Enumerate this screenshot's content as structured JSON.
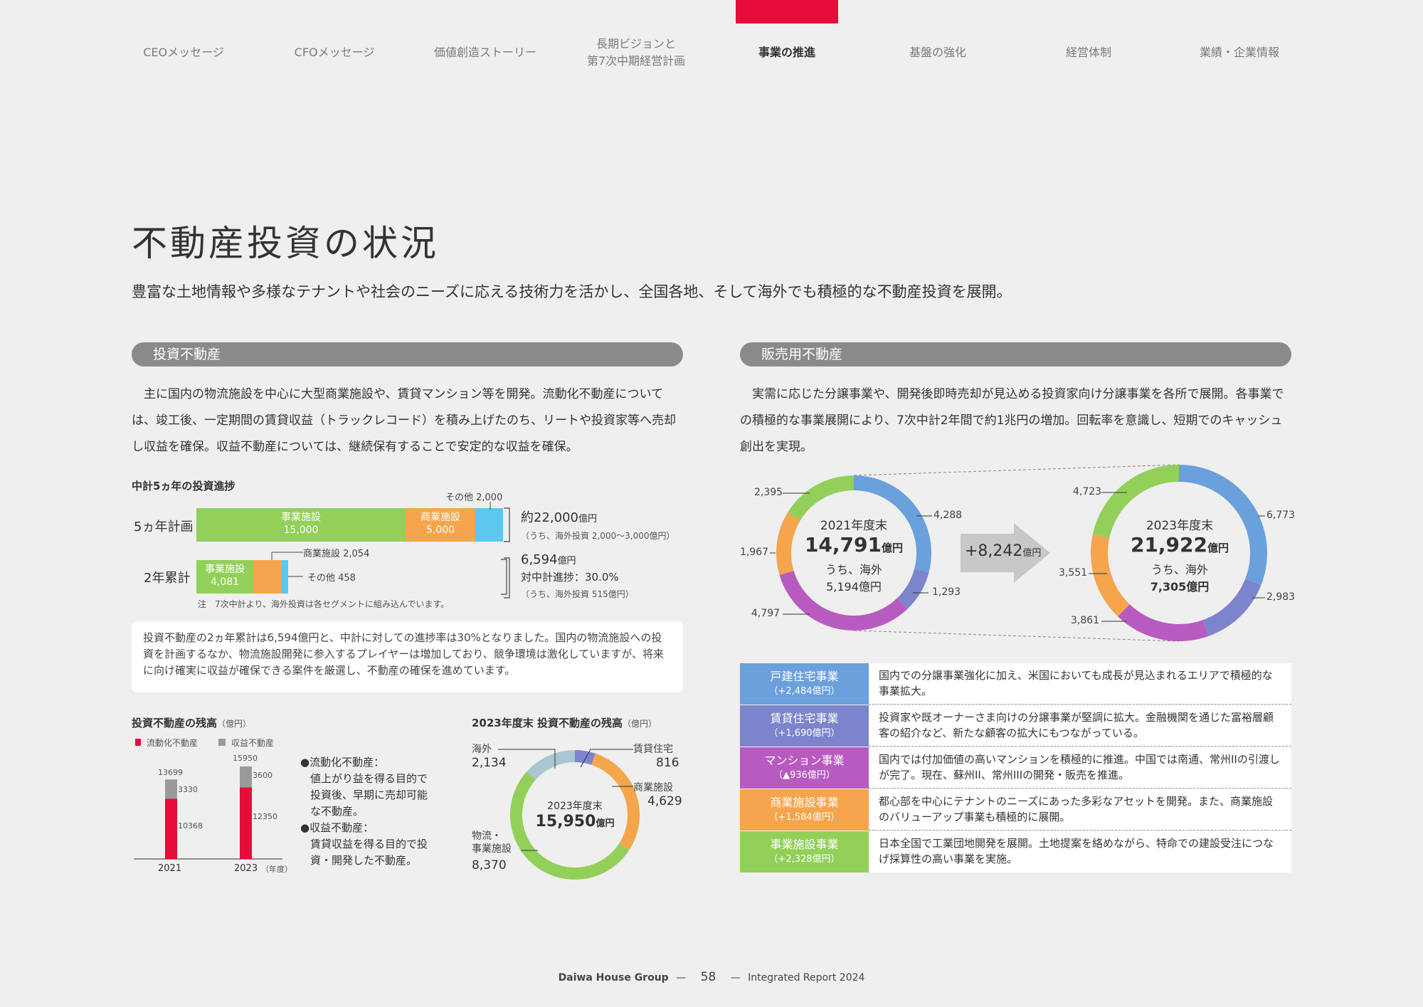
{
  "nav": {
    "items": [
      {
        "label": "CEOメッセージ"
      },
      {
        "label": "CFOメッセージ"
      },
      {
        "label": "価値創造ストーリー"
      },
      {
        "label": "長期ビジョンと\n第7次中期経営計画"
      },
      {
        "label": "事業の推進"
      },
      {
        "label": "基盤の強化"
      },
      {
        "label": "経営体制"
      },
      {
        "label": "業績・企業情報"
      }
    ]
  },
  "title": "不動産投資の状況",
  "lead": "豊富な土地情報や多様なテナントや社会のニーズに応える技術力を活かし、全国各地、そして海外でも積極的な不動産投資を展開。",
  "left": {
    "section": "投資不動産",
    "body": "主に国内の物流施設を中心に大型商業施設や、賃貸マンション等を開発。流動化不動産については、竣工後、一定期間の賃貸収益（トラックレコード）を積み上げたのち、リートや投資家等へ売却し収益を確保。収益不動産については、継続保有することで安定的な収益を確保。",
    "progress": {
      "heading": "中計5ヵ年の投資進捗",
      "row1_label": "5ヵ年計画",
      "row2_label": "2年累計",
      "plan_seg1_name": "事業施設",
      "plan_seg1_val": "15,000",
      "plan_seg2_name": "商業施設",
      "plan_seg2_val": "5,000",
      "plan_other": "その他 2,000",
      "plan_total": "約22,000",
      "plan_total_unit": "億円",
      "plan_note": "（うち、海外投資 2,000～3,000億円）",
      "act_seg1_name": "事業施設",
      "act_seg1_val": "4,081",
      "act_commercial": "商業施設 2,054",
      "act_other": "その他 458",
      "act_total": "6,594",
      "act_total_unit": "億円",
      "act_progress": "対中計進捗：30.0%",
      "act_note": "（うち、海外投資 515億円）",
      "footnote": "注　7次中計より、海外投資は各セグメントに組み込んでいます。"
    },
    "note": "投資不動産の2ヵ年累計は6,594億円と、中計に対しての進捗率は30%となりました。国内の物流施設への投資を計画するなか、物流施設開発に参入するプレイヤーは増加しており、競争環境は激化していますが、将来に向け確実に収益が確保できる案件を厳選し、不動産の確保を進めています。",
    "balance": {
      "heading": "投資不動産の残高",
      "unit": "（億円）",
      "legend1": "流動化不動産",
      "legend2": "収益不動産",
      "year_unit": "（年度）",
      "bullet1_title": "●流動化不動産：",
      "bullet1_body": "値上がり益を得る目的で投資後、早期に売却可能な不動産。",
      "bullet2_title": "●収益不動産：",
      "bullet2_body": "賃貸収益を得る目的で投資・開発した不動産。"
    },
    "pie": {
      "heading": "2023年度末 投資不動産の残高",
      "unit": "（億円）",
      "center1": "2023年度末",
      "center2": "15,950",
      "center_unit": "億円",
      "lab_overseas": "海外",
      "val_overseas": "2,134",
      "lab_rental": "賃貸住宅",
      "val_rental": "816",
      "lab_commercial": "商業施設",
      "val_commercial": "4,629",
      "lab_logistics": "物流・\n事業施設",
      "val_logistics": "8,370"
    }
  },
  "right": {
    "section": "販売用不動産",
    "body": "実需に応じた分譲事業や、開発後即時売却が見込める投資家向け分譲事業を各所で展開。各事業での積極的な事業展開により、7次中計2年間で約1兆円の増加。回転率を意識し、短期でのキャッシュ創出を実現。",
    "donut2021": {
      "l1": "2021年度末",
      "l2": "14,791",
      "u": "億円",
      "l3": "うち、海外",
      "l4": "5,194億円",
      "v_blue": "4,288",
      "v_purple": "1,293",
      "v_magenta": "4,797",
      "v_orange": "1,967",
      "v_green": "2,395"
    },
    "increase": "+8,242",
    "increase_unit": "億円",
    "donut2023": {
      "l1": "2023年度末",
      "l2": "21,922",
      "u": "億円",
      "l3": "うち、海外",
      "l4": "7,305億円",
      "v_blue": "6,773",
      "v_purple": "2,983",
      "v_magenta": "3,861",
      "v_orange": "3,551",
      "v_green": "4,723"
    },
    "table": [
      {
        "cat": "戸建住宅事業",
        "sub": "（+2,484億円）",
        "desc": "国内での分譲事業強化に加え、米国においても成長が見込まれるエリアで積極的な事業拡大。",
        "color": "#6aa0dc"
      },
      {
        "cat": "賃貸住宅事業",
        "sub": "（+1,690億円）",
        "desc": "投資家や既オーナーさま向けの分譲事業が堅調に拡大。金融機関を通じた富裕層顧客の紹介など、新たな顧客の拡大にもつながっている。",
        "color": "#7c84cc"
      },
      {
        "cat": "マンション事業",
        "sub": "（▲936億円）",
        "desc": "国内では付加価値の高いマンションを積極的に推進。中国では南通、常州IIの引渡しが完了。現在、蘇州II、常州IIIの開発・販売を推進。",
        "color": "#b85bc0"
      },
      {
        "cat": "商業施設事業",
        "sub": "（+1,584億円）",
        "desc": "都心部を中心にテナントのニーズにあった多彩なアセットを開発。また、商業施設のバリューアップ事業も積極的に展開。",
        "color": "#f5a54c"
      },
      {
        "cat": "事業施設事業",
        "sub": "（+2,328億円）",
        "desc": "日本全国で工業団地開発を展開。土地提案を絡めながら、特命での建設受注につなげ採算性の高い事業を実施。",
        "color": "#92d05a"
      }
    ]
  },
  "footer": {
    "brand": "Daiwa House Group",
    "page": "58",
    "report": "Integrated Report 2024"
  },
  "chart_data": [
    {
      "type": "bar",
      "title": "中計5ヵ年の投資進捗",
      "orientation": "horizontal-stacked",
      "categories": [
        "5ヵ年計画",
        "2年累計"
      ],
      "series": [
        {
          "name": "事業施設",
          "values": [
            15000,
            4081
          ]
        },
        {
          "name": "商業施設",
          "values": [
            5000,
            2054
          ]
        },
        {
          "name": "その他",
          "values": [
            2000,
            458
          ]
        }
      ]
    },
    {
      "type": "bar",
      "title": "投資不動産の残高",
      "categories": [
        "2021",
        "2023"
      ],
      "series": [
        {
          "name": "流動化不動産",
          "values": [
            10368,
            12350
          ]
        },
        {
          "name": "収益不動産",
          "values": [
            3330,
            3600
          ]
        }
      ],
      "totals": [
        13699,
        15950
      ]
    },
    {
      "type": "pie",
      "title": "2023年度末 投資不動産の残高",
      "categories": [
        "海外",
        "賃貸住宅",
        "商業施設",
        "物流・事業施設"
      ],
      "values": [
        2134,
        816,
        4629,
        8370
      ]
    },
    {
      "type": "pie",
      "title": "2021年度末",
      "categories": [
        "戸建住宅",
        "賃貸住宅",
        "マンション",
        "商業施設",
        "事業施設"
      ],
      "values": [
        4288,
        1293,
        4797,
        1967,
        2395
      ]
    },
    {
      "type": "pie",
      "title": "2023年度末",
      "categories": [
        "戸建住宅",
        "賃貸住宅",
        "マンション",
        "商業施設",
        "事業施設"
      ],
      "values": [
        6773,
        2983,
        3861,
        3551,
        4723
      ]
    }
  ]
}
